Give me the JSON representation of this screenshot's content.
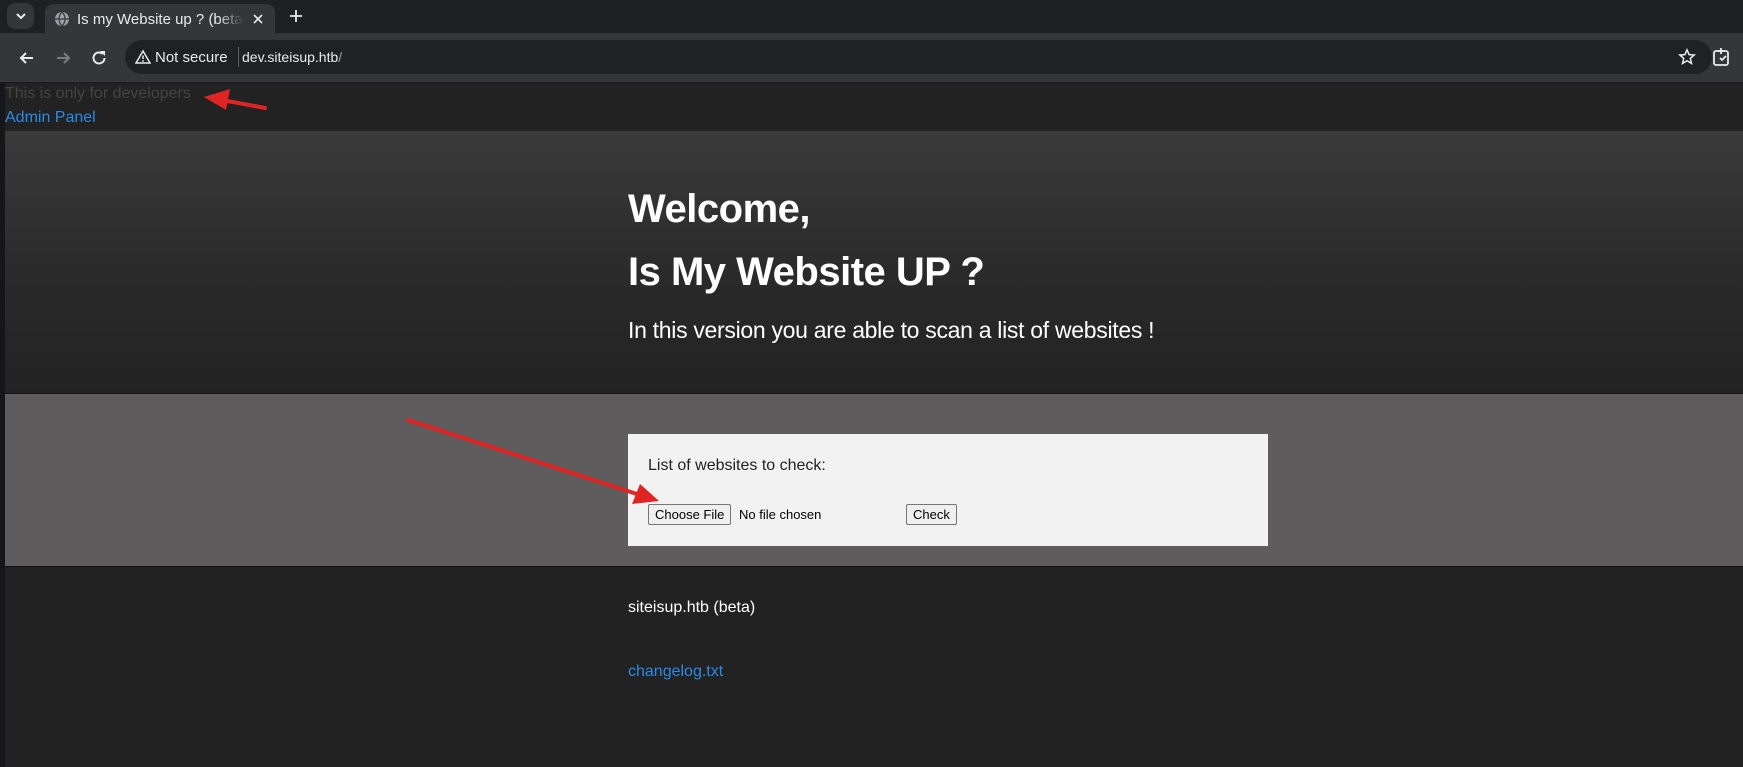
{
  "browser": {
    "tab_title": "Is my Website up ? (beta version)",
    "new_tab_icon": "plus-icon",
    "security_label": "Not secure",
    "url_host": "dev.siteisup.htb",
    "url_path": "/"
  },
  "page": {
    "dev_note": "This is only for developers",
    "admin_link": "Admin Panel",
    "hero": {
      "welcome": "Welcome,",
      "headline": "Is My Website UP ?",
      "lead": "In this version you are able to scan a list of websites !"
    },
    "form": {
      "label": "List of websites to check:",
      "choose_file_label": "Choose File",
      "file_status": "No file chosen",
      "check_label": "Check"
    },
    "footer": {
      "brand": "siteisup.htb (beta)",
      "changelog_link": "changelog.txt"
    }
  },
  "colors": {
    "link": "#2a8ae6",
    "annotation_arrow": "#e02424",
    "form_band": "#5e5c5c",
    "page_bg": "#222222"
  }
}
